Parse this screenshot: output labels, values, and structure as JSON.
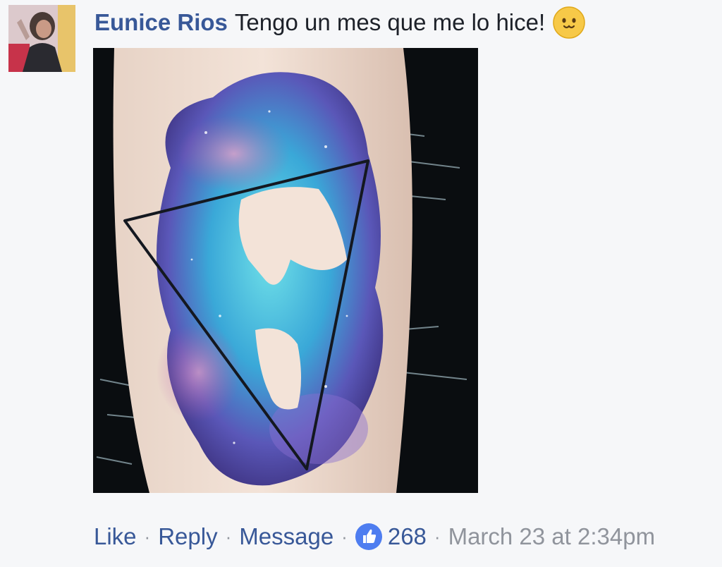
{
  "comment": {
    "author": "Eunice Rios",
    "text": "Tengo un mes que me lo hice!",
    "emoji_icon": "happy-face-emoji-icon"
  },
  "actions": {
    "like_label": "Like",
    "reply_label": "Reply",
    "message_label": "Message",
    "separator": "·",
    "like_count": "268",
    "timestamp": "March 23 at 2:34pm"
  },
  "colors": {
    "link": "#385898",
    "meta": "#90949c",
    "text": "#1d2129",
    "background": "#f6f7f9",
    "like_badge": "#4e7df0"
  }
}
